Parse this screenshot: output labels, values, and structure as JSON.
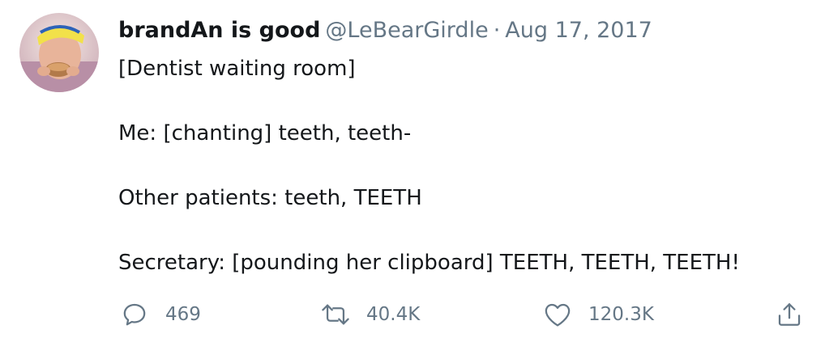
{
  "tweet": {
    "display_name": "brandAn is good",
    "handle": "@LeBearGirdle",
    "separator": "·",
    "date": "Aug 17, 2017",
    "lines": [
      "[Dentist waiting room]",
      "Me: [chanting] teeth, teeth-",
      "Other patients: teeth, TEETH",
      "Secretary: [pounding her clipboard] TEETH, TEETH, TEETH!"
    ]
  },
  "actions": {
    "reply": {
      "icon": "reply-icon",
      "count": "469"
    },
    "retweet": {
      "icon": "retweet-icon",
      "count": "40.4K"
    },
    "like": {
      "icon": "heart-icon",
      "count": "120.3K"
    },
    "share": {
      "icon": "share-icon"
    }
  },
  "colors": {
    "text": "#14171a",
    "secondary": "#657786",
    "background": "#ffffff"
  }
}
